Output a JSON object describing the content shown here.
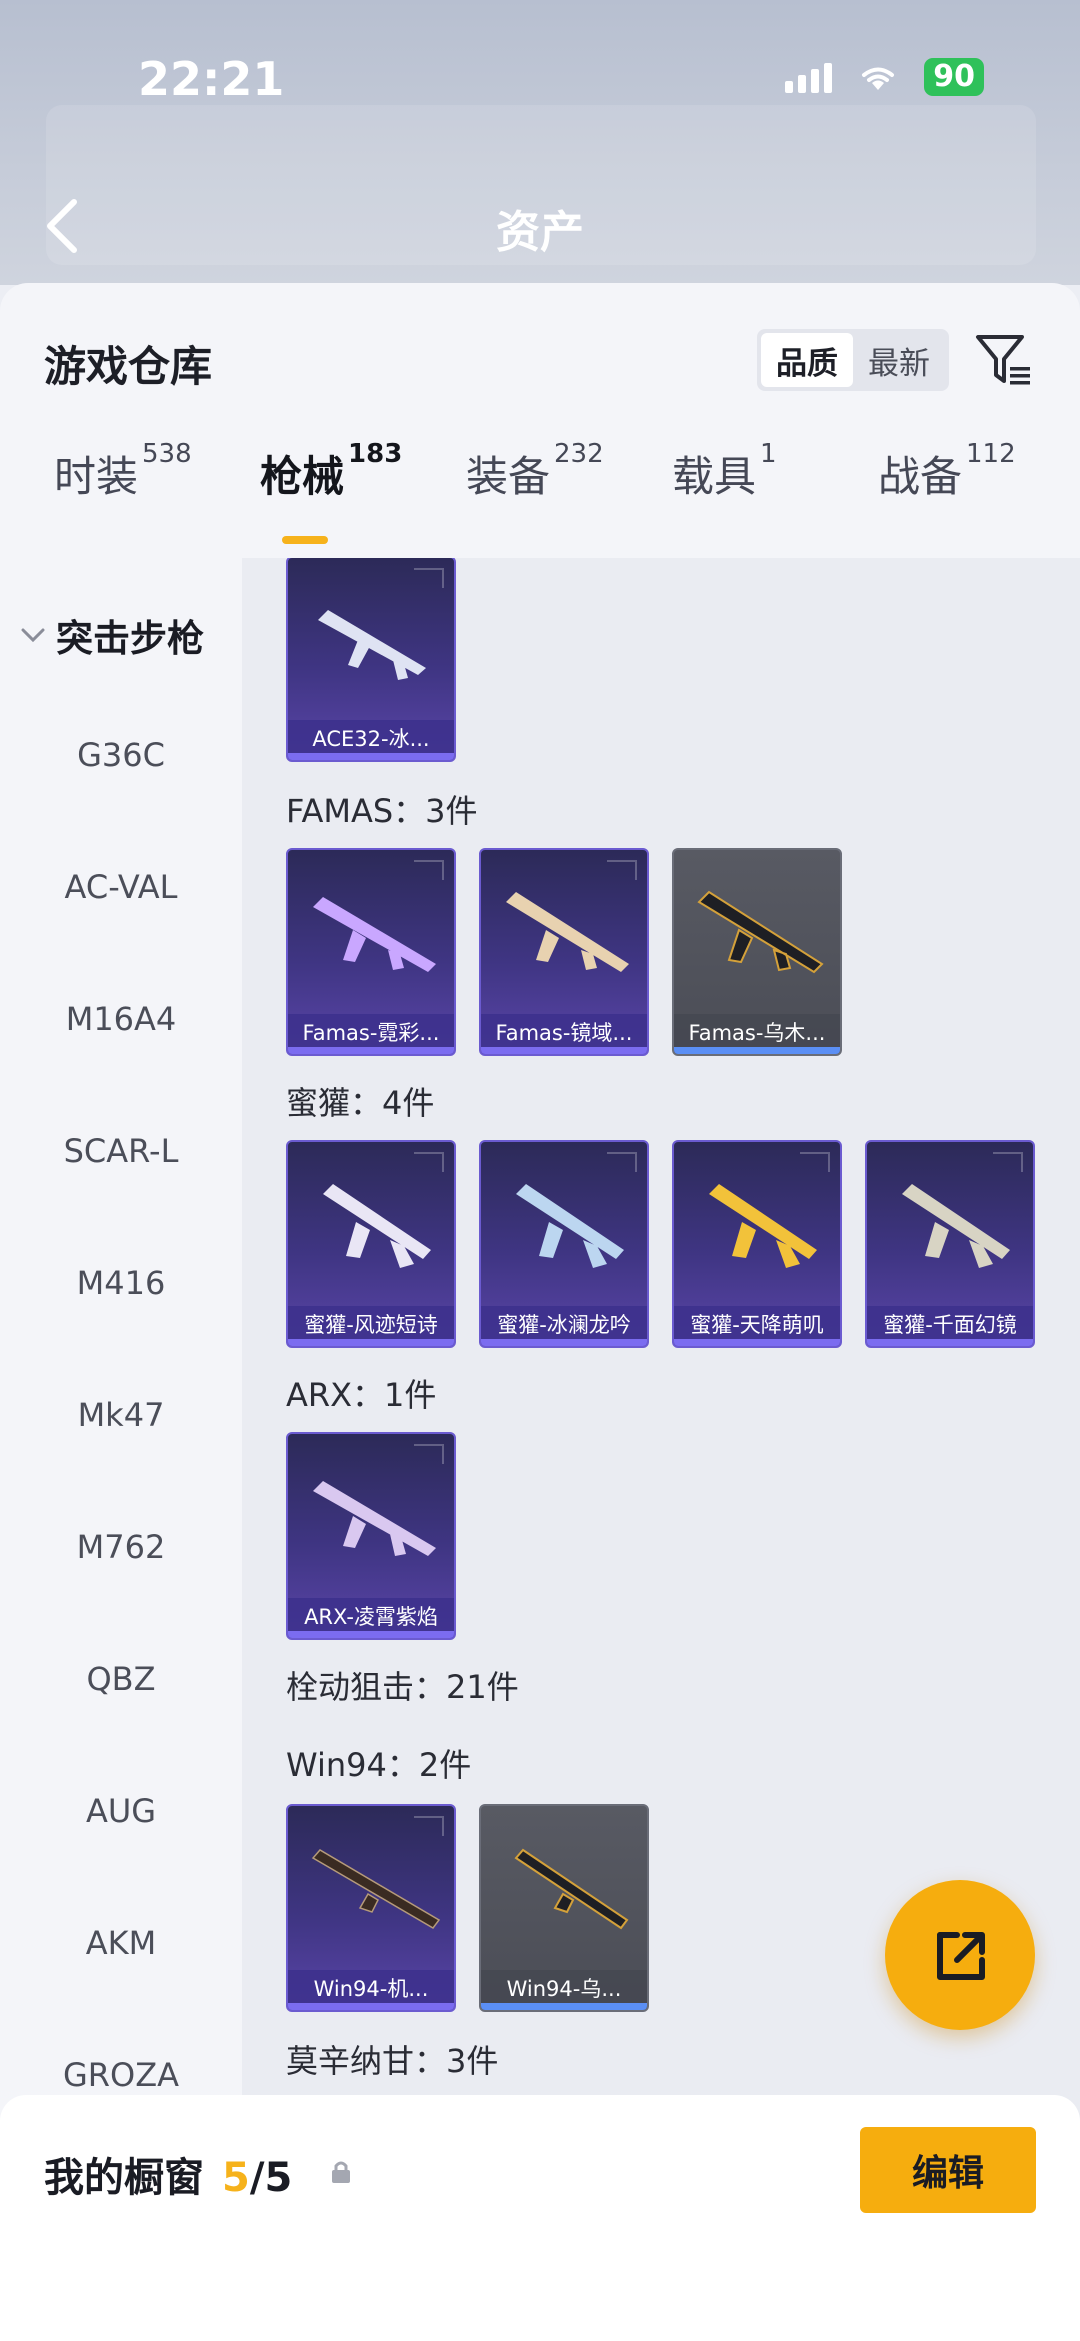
{
  "status": {
    "time": "22:21",
    "battery": "90"
  },
  "header": {
    "title": "资产"
  },
  "sheet": {
    "title": "游戏仓库",
    "sort_options": [
      {
        "label": "品质",
        "active": true
      },
      {
        "label": "最新",
        "active": false
      }
    ]
  },
  "tabs": [
    {
      "label": "时装",
      "count": "538"
    },
    {
      "label": "枪械",
      "count": "183"
    },
    {
      "label": "装备",
      "count": "232"
    },
    {
      "label": "载具",
      "count": "1"
    },
    {
      "label": "战备",
      "count": "112"
    }
  ],
  "sidebar": {
    "category": "突击步枪",
    "items": [
      "G36C",
      "AC-VAL",
      "M16A4",
      "SCAR-L",
      "M416",
      "Mk47",
      "M762",
      "QBZ",
      "AUG",
      "AKM",
      "GROZA"
    ]
  },
  "groups": {
    "ace32": {
      "items": [
        "ACE32-冰..."
      ]
    },
    "famas": {
      "title": "FAMAS：3件",
      "items": [
        "Famas-霓彩...",
        "Famas-镜域...",
        "Famas-乌木..."
      ]
    },
    "mihuo": {
      "title": "蜜獾：4件",
      "items": [
        "蜜獾-风迹短诗",
        "蜜獾-冰澜龙吟",
        "蜜獾-天降萌叽",
        "蜜獾-千面幻镜"
      ]
    },
    "arx": {
      "title": "ARX：1件",
      "items": [
        "ARX-凌霄紫焰"
      ]
    },
    "bolt": {
      "title": "栓动狙击：21件"
    },
    "win94": {
      "title": "Win94：2件",
      "items": [
        "Win94-机...",
        "Win94-乌..."
      ]
    },
    "mosin": {
      "title": "莫辛纳甘：3件"
    }
  },
  "bottom": {
    "title": "我的橱窗",
    "current": "5",
    "total": "/5",
    "edit_label": "编辑"
  },
  "colors": {
    "accent": "#f6ad0e",
    "epic_card": "#3f3583",
    "common_card": "#4b4d56"
  }
}
